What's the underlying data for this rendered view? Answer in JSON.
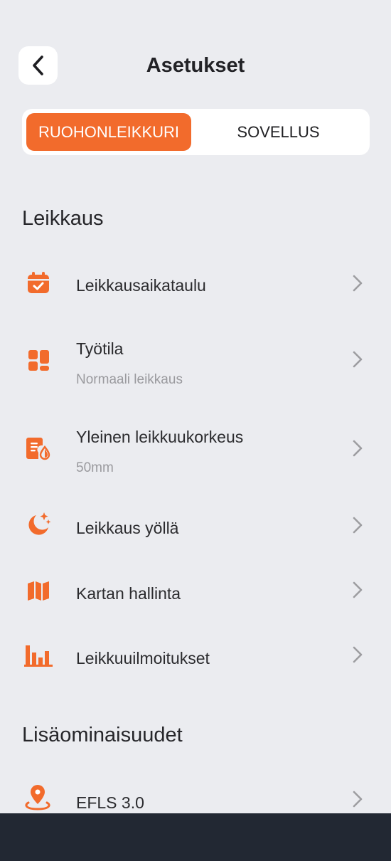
{
  "header": {
    "title": "Asetukset",
    "back_icon": "chevron-left-icon"
  },
  "tabs": [
    {
      "label": "RUOHONLEIKKURI",
      "active": true
    },
    {
      "label": "SOVELLUS",
      "active": false
    }
  ],
  "colors": {
    "accent": "#f26b2c",
    "background": "#ebecf0",
    "bottom_bar": "#222833"
  },
  "sections": [
    {
      "title": "Leikkaus",
      "items": [
        {
          "label": "Leikkausaikataulu",
          "sublabel": "",
          "icon": "calendar-check-icon"
        },
        {
          "label": "Työtila",
          "sublabel": "Normaali leikkaus",
          "icon": "layout-blocks-icon"
        },
        {
          "label": "Yleinen leikkuukorkeus",
          "sublabel": "50mm",
          "icon": "document-height-icon"
        },
        {
          "label": "Leikkaus yöllä",
          "sublabel": "",
          "icon": "moon-stars-icon"
        },
        {
          "label": "Kartan hallinta",
          "sublabel": "",
          "icon": "map-icon"
        },
        {
          "label": "Leikkuuilmoitukset",
          "sublabel": "",
          "icon": "bar-chart-icon"
        }
      ]
    },
    {
      "title": "Lisäominaisuudet",
      "items": [
        {
          "label": "EFLS 3.0",
          "sublabel": "",
          "icon": "location-pin-icon"
        }
      ]
    }
  ]
}
